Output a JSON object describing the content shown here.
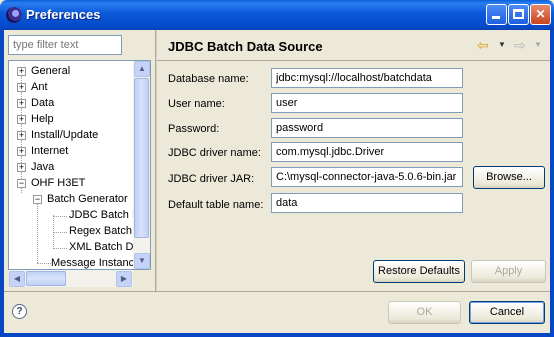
{
  "window": {
    "title": "Preferences"
  },
  "filter": {
    "placeholder": "type filter text"
  },
  "tree": {
    "items": [
      {
        "label": "General",
        "expanded": false
      },
      {
        "label": "Ant",
        "expanded": false
      },
      {
        "label": "Data",
        "expanded": false
      },
      {
        "label": "Help",
        "expanded": false
      },
      {
        "label": "Install/Update",
        "expanded": false
      },
      {
        "label": "Internet",
        "expanded": false
      },
      {
        "label": "Java",
        "expanded": false
      },
      {
        "label": "OHF H3ET",
        "expanded": true
      },
      {
        "label": "Batch Generator",
        "expanded": true
      },
      {
        "label": "JDBC Batch D"
      },
      {
        "label": "Regex Batch I"
      },
      {
        "label": "XML Batch Da"
      },
      {
        "label": "Message Instance"
      }
    ]
  },
  "page": {
    "title": "JDBC Batch Data Source",
    "fields": {
      "database_name": {
        "label": "Database name:",
        "value": "jdbc:mysql://localhost/batchdata"
      },
      "user_name": {
        "label": "User name:",
        "value": "user"
      },
      "password": {
        "label": "Password:",
        "value": "password"
      },
      "driver_name": {
        "label": "JDBC driver name:",
        "value": "com.mysql.jdbc.Driver"
      },
      "driver_jar": {
        "label": "JDBC driver JAR:",
        "value": "C:\\mysql-connector-java-5.0.6-bin.jar"
      },
      "default_table": {
        "label": "Default table name:",
        "value": "data"
      }
    },
    "browse_label": "Browse...",
    "restore_defaults_label": "Restore Defaults",
    "apply_label": "Apply"
  },
  "footer": {
    "ok_label": "OK",
    "cancel_label": "Cancel",
    "help_glyph": "?"
  },
  "icons": [
    "eclipse-icon",
    "minimize-icon",
    "maximize-icon",
    "close-icon",
    "back-arrow-icon",
    "forward-arrow-icon",
    "help-icon"
  ],
  "colors": {
    "titlebar": "#0b58d9",
    "window_bg": "#ece9d8",
    "border": "#7f9db9"
  }
}
